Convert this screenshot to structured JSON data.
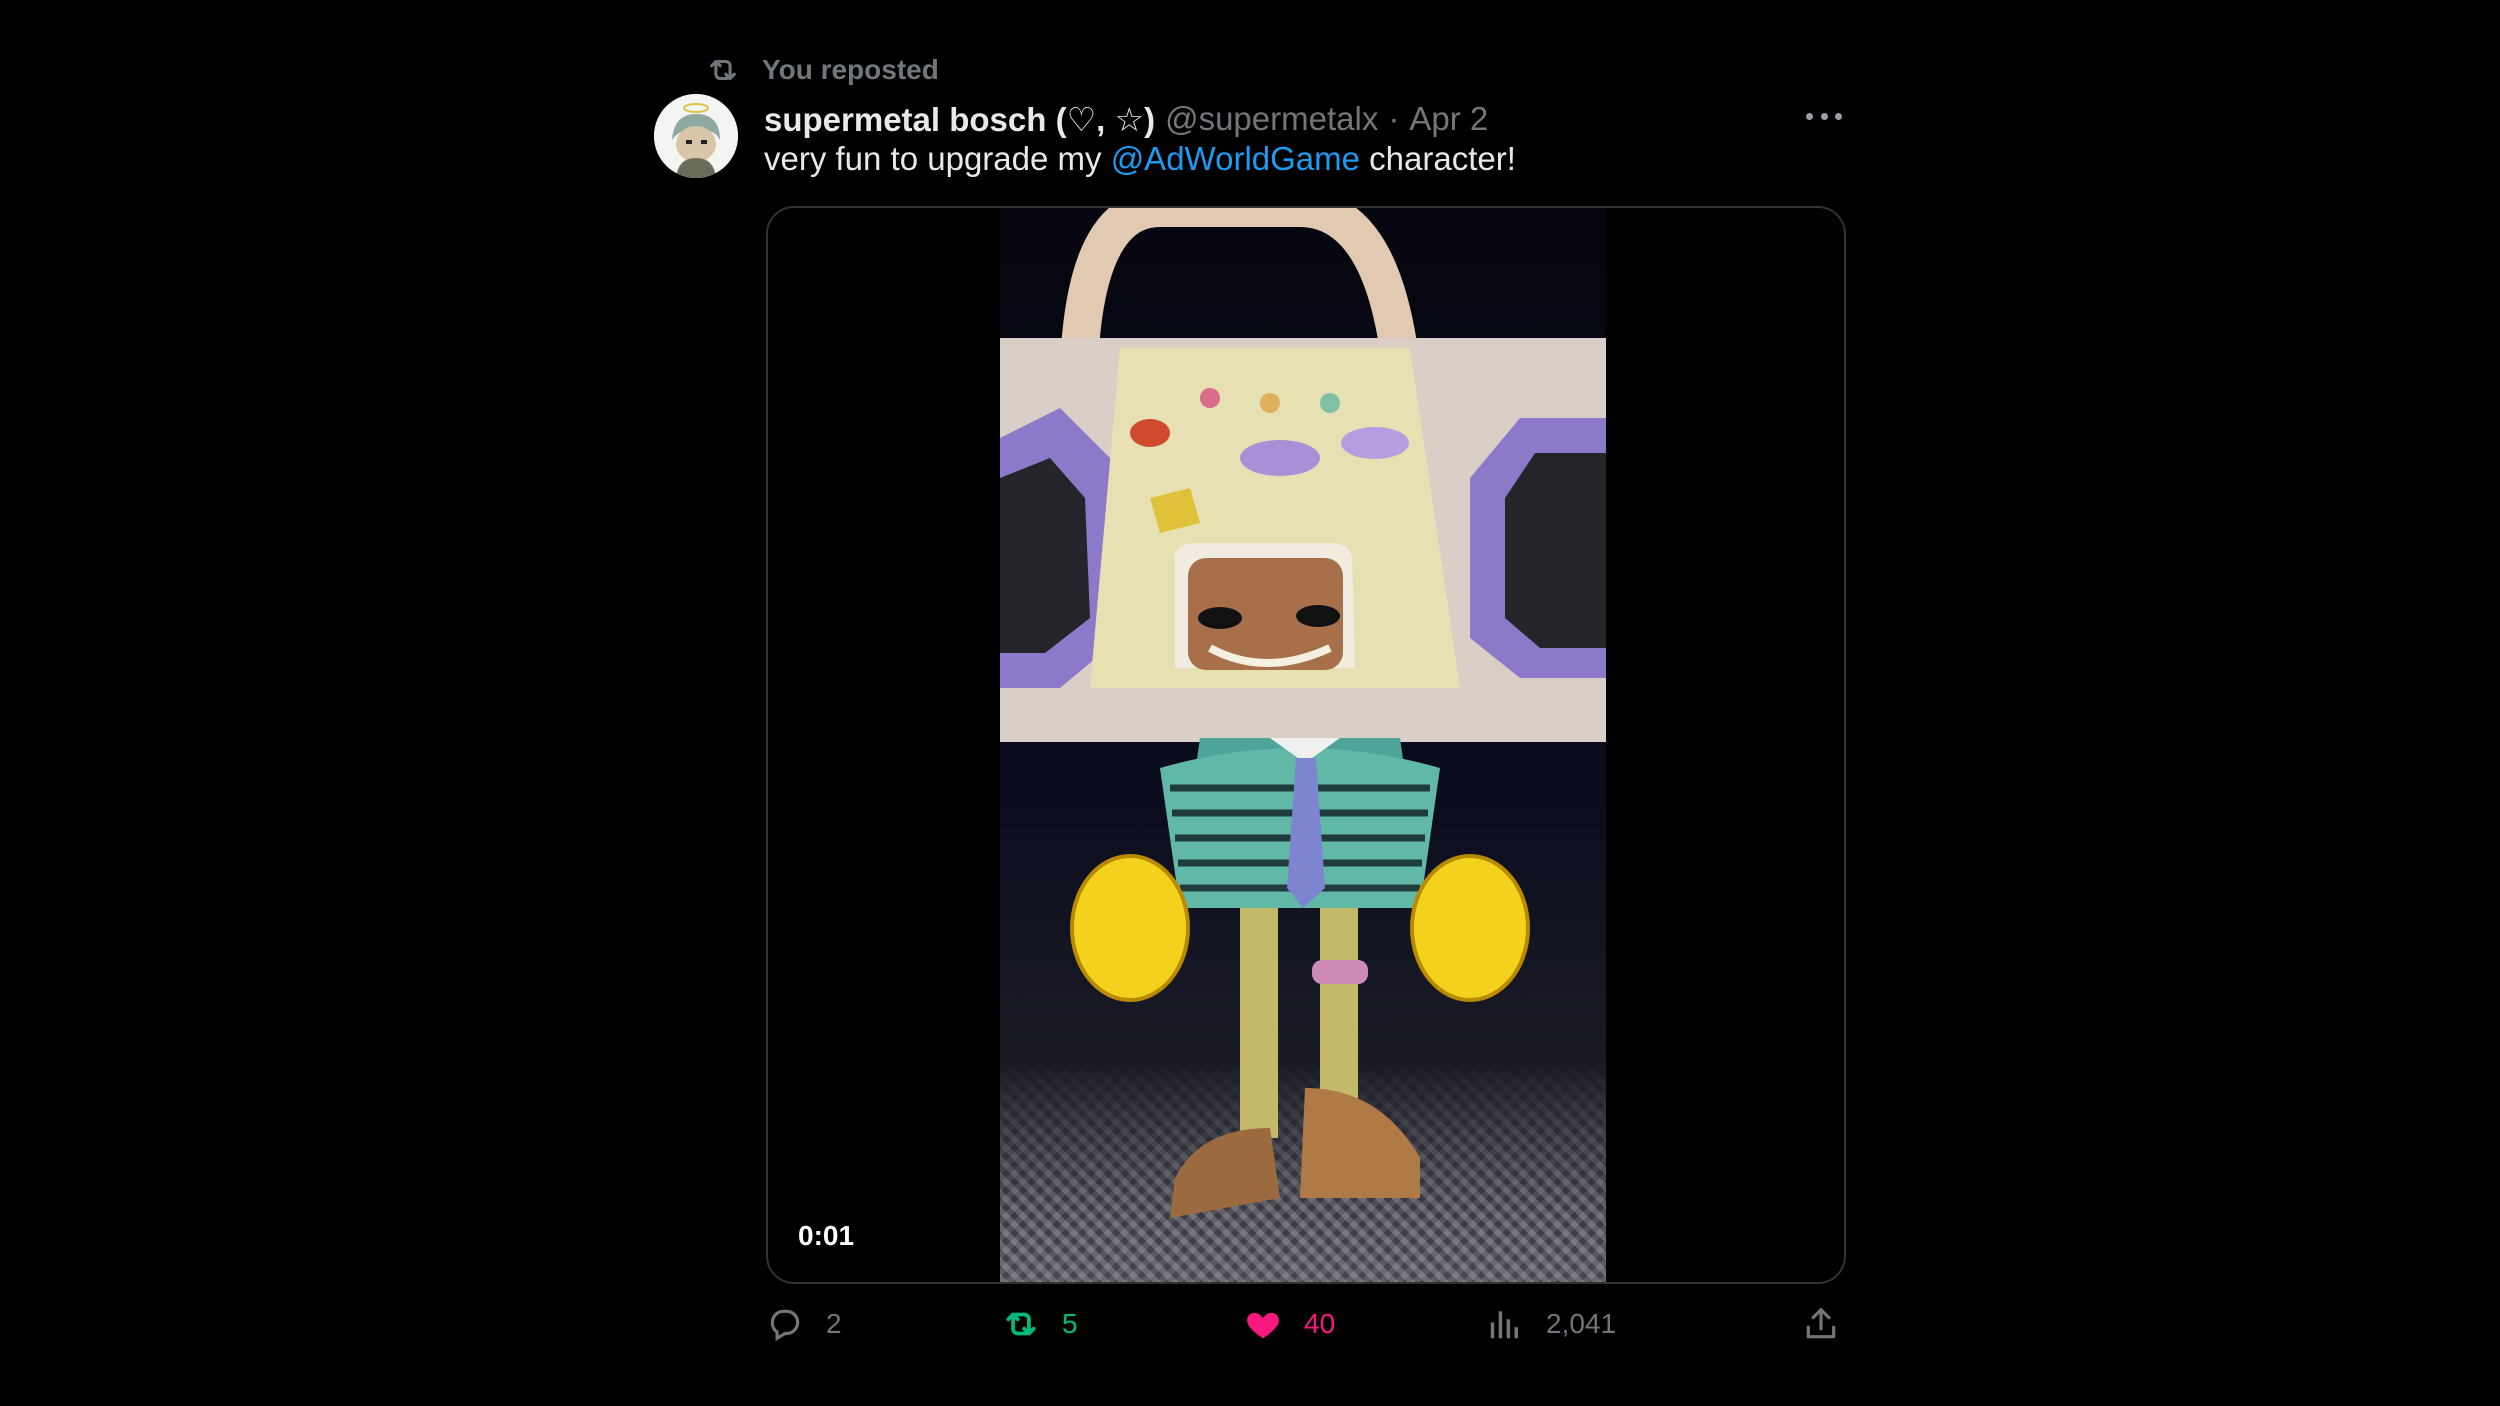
{
  "repost_banner": {
    "icon": "repost-icon",
    "label": "You reposted"
  },
  "author": {
    "display_name": "supermetal bosch (♡, ☆)",
    "handle": "@supermetalx",
    "separator": "·",
    "date": "Apr 2"
  },
  "tweet": {
    "text_before": "very fun to upgrade my ",
    "mention": "@AdWorldGame",
    "text_after": " character!"
  },
  "media": {
    "type": "video",
    "timestamp": "0:01"
  },
  "actions": {
    "replies": "2",
    "reposts": "5",
    "likes": "40",
    "views": "2,041"
  },
  "colors": {
    "background": "#000000",
    "text": "#e7e9ea",
    "muted": "#71767b",
    "link": "#1d9bf0",
    "repost_active": "#00ba7c",
    "like_active": "#f91880"
  }
}
